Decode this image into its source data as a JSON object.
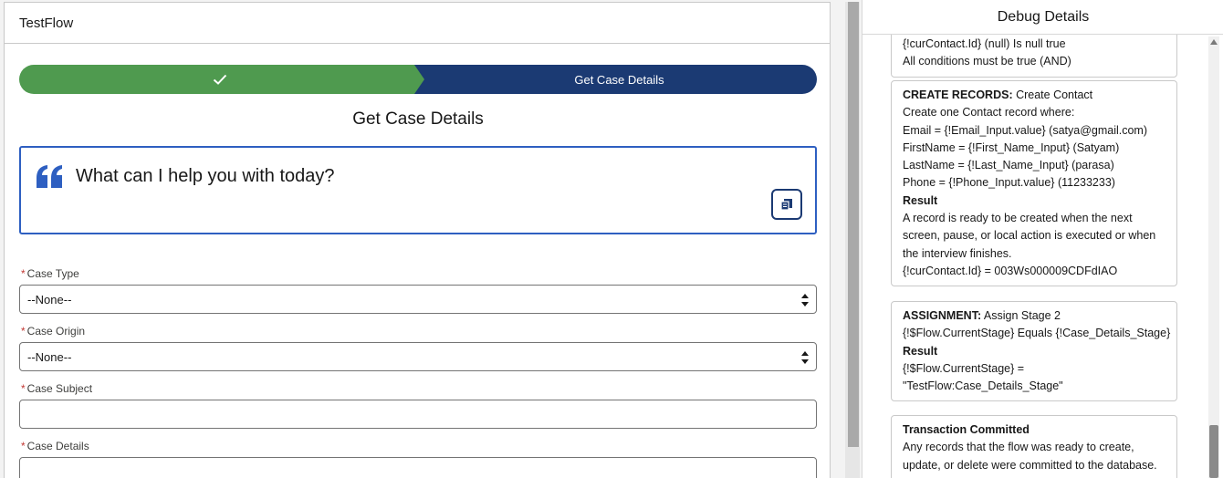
{
  "flow": {
    "title": "TestFlow",
    "progress_current_label": "Get Case Details",
    "screen_title": "Get Case Details",
    "quote_text": "What can I help you with today?",
    "fields": [
      {
        "label": "Case Type",
        "value": "--None--"
      },
      {
        "label": "Case Origin",
        "value": "--None--"
      },
      {
        "label": "Case Subject",
        "value": ""
      },
      {
        "label": "Case Details",
        "value": ""
      }
    ],
    "required_marker": "*"
  },
  "debug": {
    "title": "Debug Details",
    "cards": [
      {
        "lines": [
          {
            "text": "{!curContact.Id} (null) Is null true"
          },
          {
            "text": "All conditions must be true (AND)"
          }
        ]
      },
      {
        "head": "CREATE RECORDS:",
        "head_rest": " Create Contact",
        "lines": [
          {
            "text": "Create one Contact record where:"
          },
          {
            "text": "Email = {!Email_Input.value} (satya@gmail.com)"
          },
          {
            "text": "FirstName = {!First_Name_Input} (Satyam)"
          },
          {
            "text": "LastName = {!Last_Name_Input} (parasa)"
          },
          {
            "text": "Phone = {!Phone_Input.value} (11233233)"
          },
          {
            "text": "Result",
            "bold": true
          },
          {
            "text": "A record is ready to be created when the next"
          },
          {
            "text": "screen, pause, or local action is executed or when"
          },
          {
            "text": "the interview finishes."
          },
          {
            "text": "{!curContact.Id} = 003Ws000009CDFdIAO"
          }
        ]
      },
      {
        "head": "ASSIGNMENT:",
        "head_rest": " Assign Stage 2",
        "lines": [
          {
            "text": "{!$Flow.CurrentStage} Equals {!Case_Details_Stage}"
          },
          {
            "text": "Result",
            "bold": true
          },
          {
            "text": "{!$Flow.CurrentStage} ="
          },
          {
            "text": "\"TestFlow:Case_Details_Stage\""
          }
        ]
      },
      {
        "head": "Transaction Committed",
        "head_rest": "",
        "lines": [
          {
            "text": "Any records that the flow was ready to create,"
          },
          {
            "text": "update, or delete were committed to the database."
          }
        ]
      }
    ]
  },
  "colors": {
    "progress_done": "#4f9a4f",
    "progress_current": "#1b3a73",
    "quote_border": "#2e5fc1",
    "required": "#c23934"
  }
}
